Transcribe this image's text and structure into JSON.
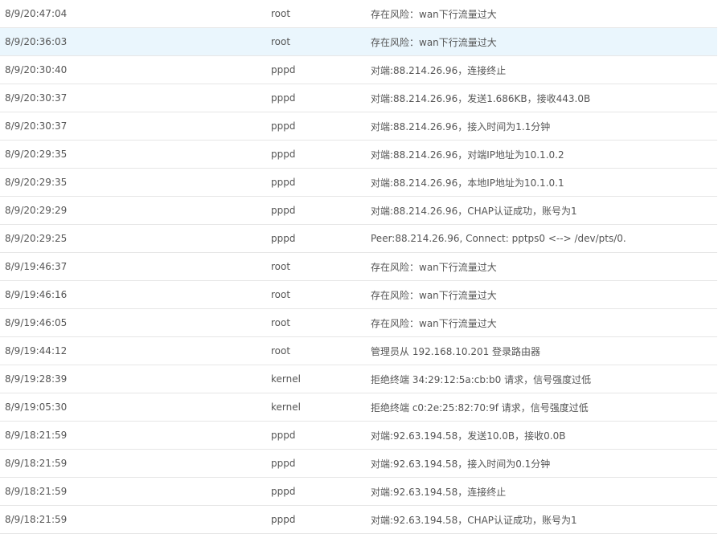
{
  "log": {
    "rows": [
      {
        "time": "8/9/20:47:04",
        "process": "root",
        "message": "存在风险：wan下行流量过大"
      },
      {
        "time": "8/9/20:36:03",
        "process": "root",
        "message": "存在风险：wan下行流量过大",
        "highlighted": true
      },
      {
        "time": "8/9/20:30:40",
        "process": "pppd",
        "message": "对端:88.214.26.96，连接终止"
      },
      {
        "time": "8/9/20:30:37",
        "process": "pppd",
        "message": "对端:88.214.26.96，发送1.686KB，接收443.0B"
      },
      {
        "time": "8/9/20:30:37",
        "process": "pppd",
        "message": "对端:88.214.26.96，接入时间为1.1分钟"
      },
      {
        "time": "8/9/20:29:35",
        "process": "pppd",
        "message": "对端:88.214.26.96，对端IP地址为10.1.0.2"
      },
      {
        "time": "8/9/20:29:35",
        "process": "pppd",
        "message": "对端:88.214.26.96，本地IP地址为10.1.0.1"
      },
      {
        "time": "8/9/20:29:29",
        "process": "pppd",
        "message": "对端:88.214.26.96，CHAP认证成功，账号为1"
      },
      {
        "time": "8/9/20:29:25",
        "process": "pppd",
        "message": "Peer:88.214.26.96, Connect: pptps0 <--> /dev/pts/0."
      },
      {
        "time": "8/9/19:46:37",
        "process": "root",
        "message": "存在风险：wan下行流量过大"
      },
      {
        "time": "8/9/19:46:16",
        "process": "root",
        "message": "存在风险：wan下行流量过大"
      },
      {
        "time": "8/9/19:46:05",
        "process": "root",
        "message": "存在风险：wan下行流量过大"
      },
      {
        "time": "8/9/19:44:12",
        "process": "root",
        "message": "管理员从 192.168.10.201 登录路由器"
      },
      {
        "time": "8/9/19:28:39",
        "process": "kernel",
        "message": "拒绝终端 34:29:12:5a:cb:b0 请求，信号强度过低"
      },
      {
        "time": "8/9/19:05:30",
        "process": "kernel",
        "message": "拒绝终端 c0:2e:25:82:70:9f 请求，信号强度过低"
      },
      {
        "time": "8/9/18:21:59",
        "process": "pppd",
        "message": "对端:92.63.194.58，发送10.0B，接收0.0B"
      },
      {
        "time": "8/9/18:21:59",
        "process": "pppd",
        "message": "对端:92.63.194.58，接入时间为0.1分钟"
      },
      {
        "time": "8/9/18:21:59",
        "process": "pppd",
        "message": "对端:92.63.194.58，连接终止"
      },
      {
        "time": "8/9/18:21:59",
        "process": "pppd",
        "message": "对端:92.63.194.58，CHAP认证成功，账号为1"
      }
    ]
  }
}
